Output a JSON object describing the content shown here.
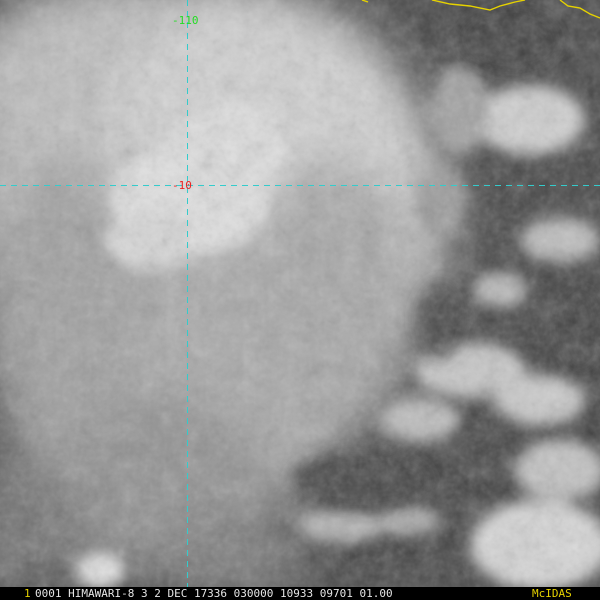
{
  "overlay": {
    "longitude_label": "-110",
    "latitude_label": "-10"
  },
  "status_bar": {
    "frame_index": "1",
    "info_text": "0001 HIMAWARI-8  3  2 DEC 17336 030000 10933 09701 01.00",
    "brand": "McIDAS"
  },
  "colors": {
    "grid_line": "#33cccc",
    "longitude_label": "#22dd22",
    "latitude_label": "#ee2222",
    "coastline": "#e6d200",
    "status_index": "#e6d200",
    "status_brand": "#e6d200",
    "status_text": "#e6e6e6"
  }
}
